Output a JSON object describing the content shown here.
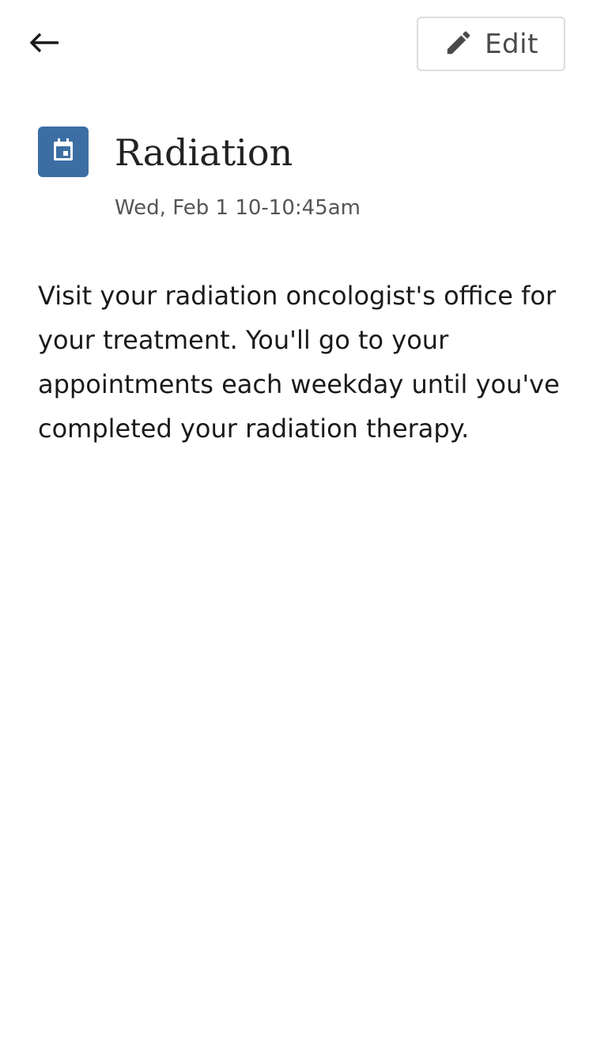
{
  "header": {
    "back_icon": "arrow-left-icon",
    "edit_icon": "pencil-icon",
    "edit_label": "Edit"
  },
  "event": {
    "icon": "calendar-icon",
    "icon_color": "#3d6ea3",
    "title": "Radiation",
    "time": "Wed, Feb 1 10-10:45am",
    "description": "Visit your radiation oncologist's office for your treatment. You'll go to your appointments each weekday until you've completed your radiation therapy."
  }
}
